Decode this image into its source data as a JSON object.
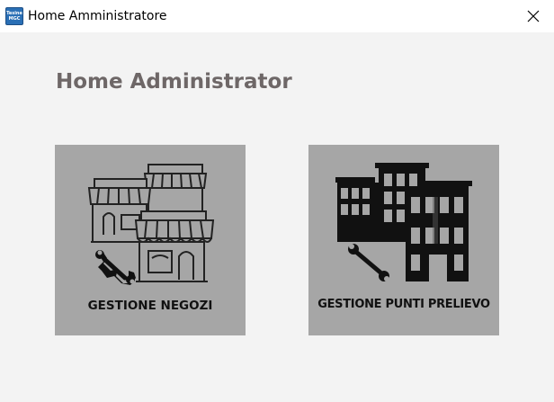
{
  "window": {
    "title": "Home Amministratore",
    "app_icon_line1": "Tesine",
    "app_icon_line2": "MGC"
  },
  "page": {
    "title": "Home Administrator"
  },
  "tiles": [
    {
      "label": "GESTIONE NEGOZI",
      "icon": "shops-wrench-icon"
    },
    {
      "label": "GESTIONE PUNTI PRELIEVO",
      "icon": "buildings-wrench-icon"
    }
  ],
  "colors": {
    "background": "#f3f3f3",
    "tile": "#a6a6a6",
    "title": "#6e6767"
  }
}
